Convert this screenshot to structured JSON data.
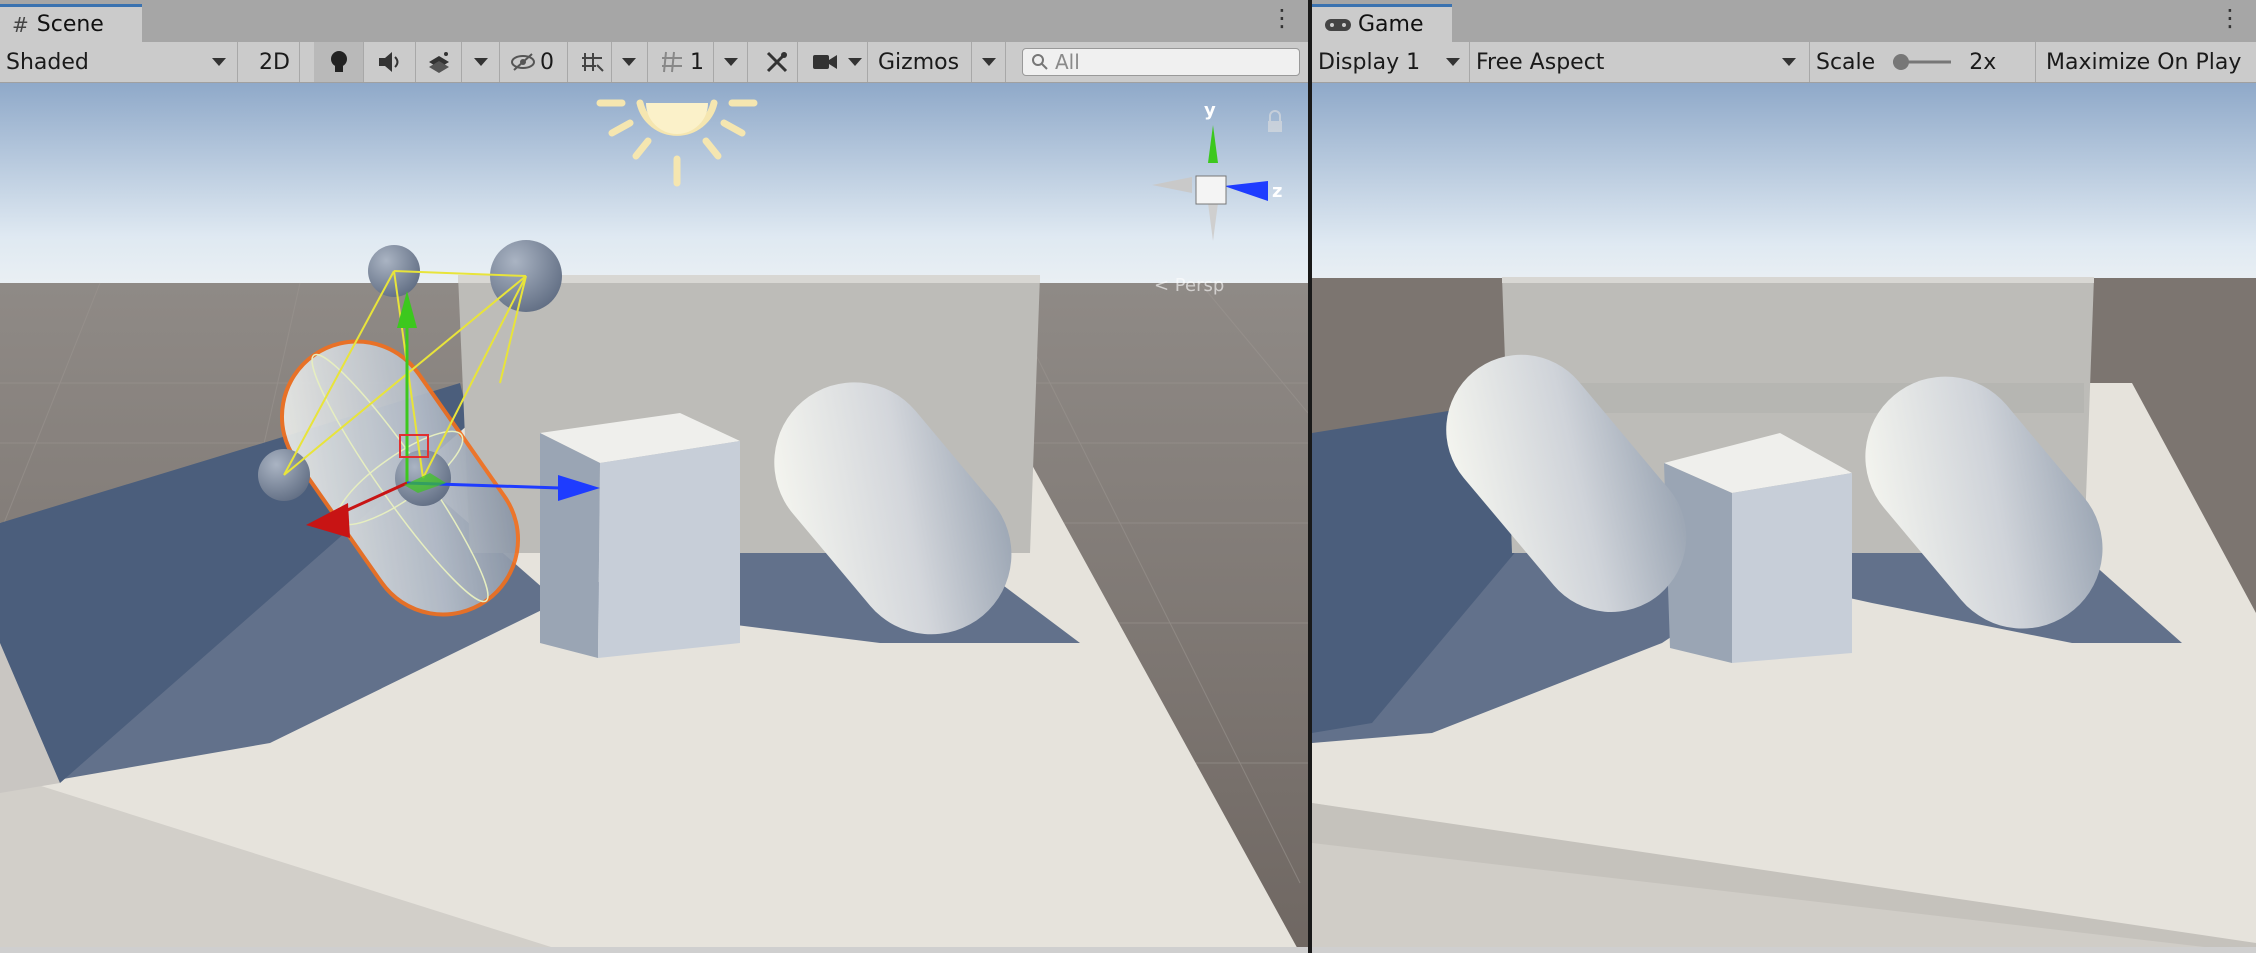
{
  "scene": {
    "tab_label": "Scene",
    "tab_icon": "grid-hash-icon",
    "toolbar": {
      "shading_mode": "Shaded",
      "mode_2d": "2D",
      "hidden_count": "0",
      "grid_count": "1",
      "gizmos_label": "Gizmos",
      "search_placeholder": "All"
    },
    "axis_gizmo": {
      "y_label": "y",
      "z_label": "z",
      "persp_label": "< Persp"
    }
  },
  "game": {
    "tab_label": "Game",
    "tab_icon": "gamepad-icon",
    "toolbar": {
      "display": "Display 1",
      "aspect": "Free Aspect",
      "scale_label": "Scale",
      "scale_value": "2x",
      "maximize_label": "Maximize On Play"
    }
  },
  "colors": {
    "selection_outline": "#f07020",
    "axis_x": "#c81414",
    "axis_y": "#3cc81e",
    "axis_z": "#1e3cff",
    "light_gizmo": "#f5e6b0",
    "tab_highlight": "#3a72b0"
  }
}
